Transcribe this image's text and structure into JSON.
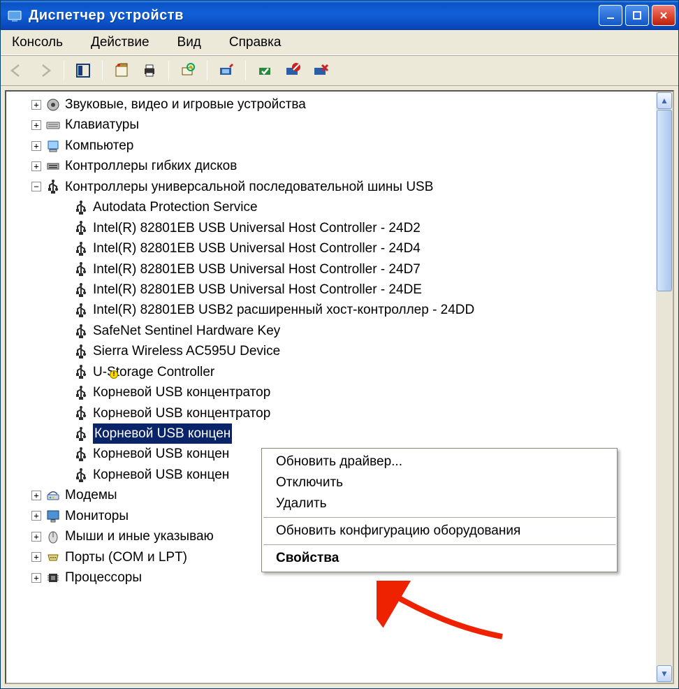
{
  "window": {
    "title": "Диспетчер устройств"
  },
  "menu": {
    "items": [
      "Консоль",
      "Действие",
      "Вид",
      "Справка"
    ]
  },
  "tree": {
    "nodes": [
      {
        "label": "Звуковые, видео и игровые устройства",
        "level": 1,
        "state": "plus",
        "icon": "sound"
      },
      {
        "label": "Клавиатуры",
        "level": 1,
        "state": "plus",
        "icon": "keyboard"
      },
      {
        "label": "Компьютер",
        "level": 1,
        "state": "plus",
        "icon": "computer"
      },
      {
        "label": "Контроллеры гибких дисков",
        "level": 1,
        "state": "plus",
        "icon": "fdc"
      },
      {
        "label": "Контроллеры универсальной последовательной шины USB",
        "level": 1,
        "state": "minus",
        "icon": "usb"
      },
      {
        "label": "Autodata Protection Service",
        "level": 2,
        "state": "leaf",
        "icon": "usb"
      },
      {
        "label": "Intel(R) 82801EB USB Universal Host Controller - 24D2",
        "level": 2,
        "state": "leaf",
        "icon": "usb"
      },
      {
        "label": "Intel(R) 82801EB USB Universal Host Controller - 24D4",
        "level": 2,
        "state": "leaf",
        "icon": "usb"
      },
      {
        "label": "Intel(R) 82801EB USB Universal Host Controller - 24D7",
        "level": 2,
        "state": "leaf",
        "icon": "usb"
      },
      {
        "label": "Intel(R) 82801EB USB Universal Host Controller - 24DE",
        "level": 2,
        "state": "leaf",
        "icon": "usb"
      },
      {
        "label": "Intel(R) 82801EB USB2 расширенный хост-контроллер - 24DD",
        "level": 2,
        "state": "leaf",
        "icon": "usb"
      },
      {
        "label": "SafeNet Sentinel Hardware Key",
        "level": 2,
        "state": "leaf",
        "icon": "usb"
      },
      {
        "label": "Sierra Wireless AC595U Device",
        "level": 2,
        "state": "leaf",
        "icon": "usb"
      },
      {
        "label": "U-Storage Controller",
        "level": 2,
        "state": "leaf",
        "icon": "usb",
        "warn": true
      },
      {
        "label": "Корневой USB концентратор",
        "level": 2,
        "state": "leaf",
        "icon": "usb"
      },
      {
        "label": "Корневой USB концентратор",
        "level": 2,
        "state": "leaf",
        "icon": "usb"
      },
      {
        "label": "Корневой USB концен",
        "level": 2,
        "state": "leaf",
        "icon": "usb",
        "selected": true
      },
      {
        "label": "Корневой USB концен",
        "level": 2,
        "state": "leaf",
        "icon": "usb"
      },
      {
        "label": "Корневой USB концен",
        "level": 2,
        "state": "leaf",
        "icon": "usb"
      },
      {
        "label": "Модемы",
        "level": 1,
        "state": "plus",
        "icon": "modem"
      },
      {
        "label": "Мониторы",
        "level": 1,
        "state": "plus",
        "icon": "monitor"
      },
      {
        "label": "Мыши и иные указываю",
        "level": 1,
        "state": "plus",
        "icon": "mouse"
      },
      {
        "label": "Порты (COM и LPT)",
        "level": 1,
        "state": "plus",
        "icon": "port"
      },
      {
        "label": "Процессоры",
        "level": 1,
        "state": "plus",
        "icon": "cpu"
      }
    ]
  },
  "contextMenu": {
    "items": [
      {
        "label": "Обновить драйвер..."
      },
      {
        "label": "Отключить"
      },
      {
        "label": "Удалить"
      },
      {
        "sep": true
      },
      {
        "label": "Обновить конфигурацию оборудования"
      },
      {
        "sep": true
      },
      {
        "label": "Свойства",
        "bold": true
      }
    ]
  }
}
